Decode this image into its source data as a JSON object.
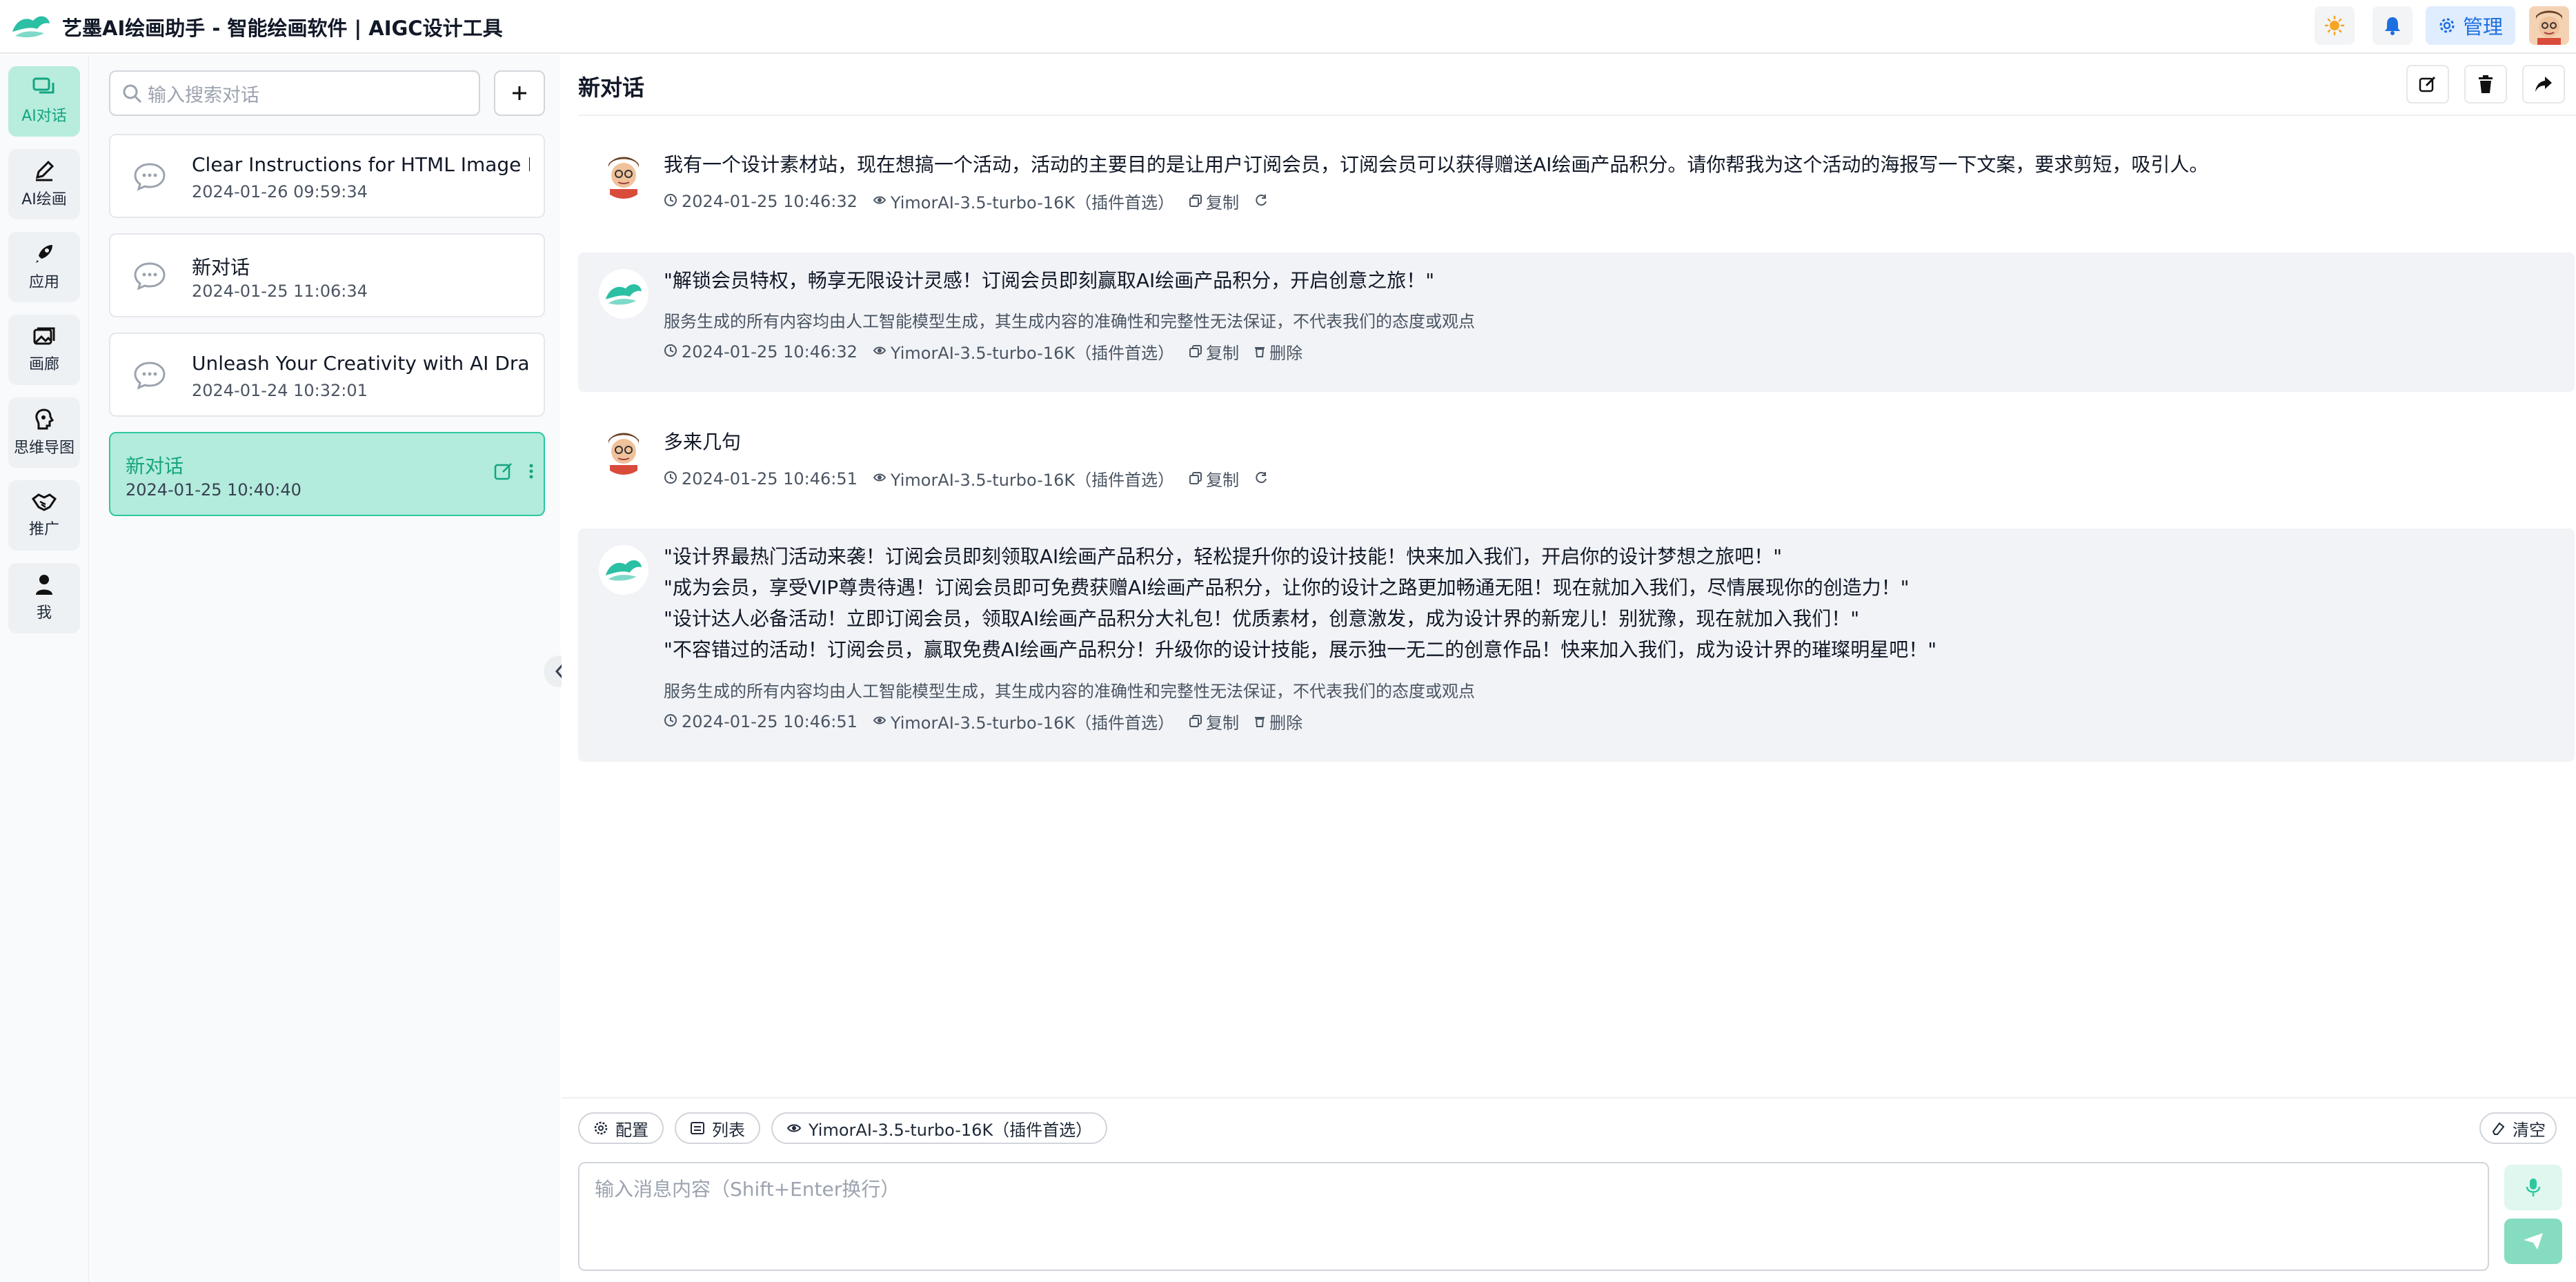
{
  "app": {
    "title": "艺墨AI绘画助手 - 智能绘画软件 | AIGC设计工具",
    "admin_label": "管理",
    "accent_color": "#13a57f"
  },
  "rail": {
    "items": [
      {
        "label": "AI对话",
        "icon": "chat-bubbles-icon",
        "active": true
      },
      {
        "label": "AI绘画",
        "icon": "pen-brush-icon"
      },
      {
        "label": "应用",
        "icon": "rocket-icon"
      },
      {
        "label": "画廊",
        "icon": "image-gallery-icon"
      },
      {
        "label": "思维导图",
        "icon": "mind-map-icon"
      },
      {
        "label": "推广",
        "icon": "handshake-icon"
      },
      {
        "label": "我",
        "icon": "user-icon"
      }
    ]
  },
  "sidebar": {
    "search_placeholder": "输入搜索对话",
    "conversations": [
      {
        "title": "Clear Instructions for HTML Image Link Re",
        "date": "2024-01-26 09:59:34"
      },
      {
        "title": "新对话",
        "date": "2024-01-25 11:06:34"
      },
      {
        "title": "Unleash Your Creativity with AI Drawing Too",
        "date": "2024-01-24 10:32:01"
      },
      {
        "title": "新对话",
        "date": "2024-01-25 10:40:40",
        "active": true
      }
    ]
  },
  "main": {
    "title": "新对话",
    "messages": [
      {
        "role": "user",
        "lines": [
          "我有一个设计素材站，现在想搞一个活动，活动的主要目的是让用户订阅会员，订阅会员可以获得赠送AI绘画产品积分。请你帮我为这个活动的海报写一下文案，要求剪短，吸引人。"
        ],
        "time": "2024-01-25 10:46:32",
        "model": "YimorAI-3.5-turbo-16K（插件首选）",
        "copy": "复制"
      },
      {
        "role": "assistant",
        "lines": [
          "\"解锁会员特权，畅享无限设计灵感！订阅会员即刻赢取AI绘画产品积分，开启创意之旅！\""
        ],
        "note": "服务生成的所有内容均由人工智能模型生成，其生成内容的准确性和完整性无法保证，不代表我们的态度或观点",
        "time": "2024-01-25 10:46:32",
        "model": "YimorAI-3.5-turbo-16K（插件首选）",
        "copy": "复制",
        "delete": "删除"
      },
      {
        "role": "user",
        "lines": [
          "多来几句"
        ],
        "time": "2024-01-25 10:46:51",
        "model": "YimorAI-3.5-turbo-16K（插件首选）",
        "copy": "复制"
      },
      {
        "role": "assistant",
        "lines": [
          "\"设计界最热门活动来袭！订阅会员即刻领取AI绘画产品积分，轻松提升你的设计技能！快来加入我们，开启你的设计梦想之旅吧！\"",
          "\"成为会员，享受VIP尊贵待遇！订阅会员即可免费获赠AI绘画产品积分，让你的设计之路更加畅通无阻！现在就加入我们，尽情展现你的创造力！\"",
          "\"设计达人必备活动！立即订阅会员，领取AI绘画产品积分大礼包！优质素材，创意激发，成为设计界的新宠儿！别犹豫，现在就加入我们！\"",
          "\"不容错过的活动！订阅会员，赢取免费AI绘画产品积分！升级你的设计技能，展示独一无二的创意作品！快来加入我们，成为设计界的璀璨明星吧！\""
        ],
        "note": "服务生成的所有内容均由人工智能模型生成，其生成内容的准确性和完整性无法保证，不代表我们的态度或观点",
        "time": "2024-01-25 10:46:51",
        "model": "YimorAI-3.5-turbo-16K（插件首选）",
        "copy": "复制",
        "delete": "删除"
      }
    ]
  },
  "composer": {
    "config_label": "配置",
    "list_label": "列表",
    "model_label": "YimorAI-3.5-turbo-16K（插件首选）",
    "clear_label": "清空",
    "placeholder": "输入消息内容（Shift+Enter换行）"
  }
}
